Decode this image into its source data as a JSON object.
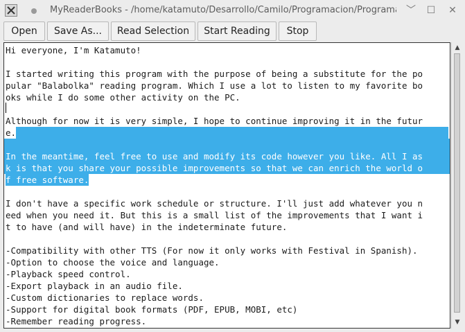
{
  "window": {
    "title": "MyReaderBooks - /home/katamuto/Desarrollo/Camilo/Programacion/Programa...",
    "minimize_glyph": "﹀",
    "maximize_glyph": "☐",
    "close_glyph": "✕"
  },
  "toolbar": {
    "open_label": "Open",
    "save_as_label": "Save As...",
    "read_selection_label": "Read Selection",
    "start_reading_label": "Start Reading",
    "stop_label": "Stop"
  },
  "editor": {
    "lines": [
      {
        "text": "Hi everyone, I'm Katamuto!",
        "selected": false
      },
      {
        "text": "",
        "selected": false
      },
      {
        "text": "I started writing this program with the purpose of being a substitute for the po",
        "selected": false
      },
      {
        "text": "pular \"Balabolka\" reading program. Which I use a lot to listen to my favorite bo",
        "selected": false
      },
      {
        "text": "oks while I do some other activity on the PC.",
        "selected": false
      },
      {
        "text": "",
        "selected": false
      },
      {
        "text": "Although for now it is very simple, I hope to continue improving it in the futur",
        "selected": false
      },
      {
        "text": "e.",
        "selected": false,
        "trailing_selected": true
      },
      {
        "text": "",
        "selected": true
      },
      {
        "text": "In the meantime, feel free to use and modify its code however you like. All I as",
        "selected": true
      },
      {
        "text": "k is that you share your possible improvements so that we can enrich the world o",
        "selected": true
      },
      {
        "text": "f free software.",
        "selected": true,
        "partial": true
      },
      {
        "text": "",
        "selected": false
      },
      {
        "text": "I don't have a specific work schedule or structure. I'll just add whatever you n",
        "selected": false
      },
      {
        "text": "eed when you need it. But this is a small list of the improvements that I want i",
        "selected": false
      },
      {
        "text": "t to have (and will have) in the indeterminate future.",
        "selected": false
      },
      {
        "text": "",
        "selected": false
      },
      {
        "text": "-Compatibility with other TTS (For now it only works with Festival in Spanish).",
        "selected": false
      },
      {
        "text": "-Option to choose the voice and language.",
        "selected": false
      },
      {
        "text": "-Playback speed control.",
        "selected": false
      },
      {
        "text": "-Export playback in an audio file.",
        "selected": false
      },
      {
        "text": "-Custom dictionaries to replace words.",
        "selected": false
      },
      {
        "text": "-Support for digital book formats (PDF, EPUB, MOBI, etc)",
        "selected": false
      },
      {
        "text": "-Remember reading progress.",
        "selected": false
      }
    ]
  },
  "colors": {
    "selection": "#3daee9",
    "window_bg": "#ececec"
  },
  "icons": {
    "app": "app-icon",
    "pin": "pin-icon",
    "scroll_up": "arrow-up-icon",
    "scroll_down": "arrow-down-icon"
  }
}
